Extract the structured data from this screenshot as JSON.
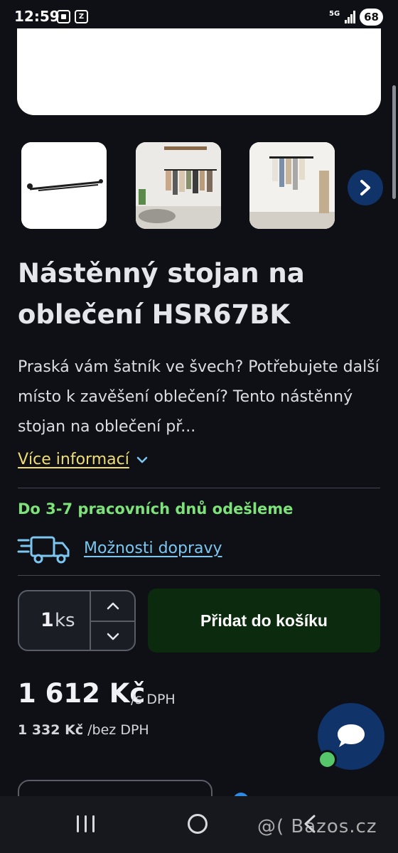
{
  "status_bar": {
    "time": "12:59",
    "network": "5G",
    "battery": "68"
  },
  "gallery": {
    "thumbnails": [
      "product-photo-rail",
      "product-photo-room",
      "product-photo-wall"
    ],
    "next_icon": "chevron-right-icon"
  },
  "product": {
    "title": "Nástěnný stojan na oblečení HSR67BK",
    "description": "Praská vám šatník ve švech? Potřebujete další místo k zavěšení oblečení? Tento nástěnný stojan na oblečení př...",
    "more_info_label": "Více informací"
  },
  "shipping": {
    "time_text": "Do 3-7 pracovních dnů odešleme",
    "options_link": "Možnosti dopravy"
  },
  "cart": {
    "quantity": "1",
    "unit": "ks",
    "add_button": "Přidat do košíku"
  },
  "price": {
    "with_vat": "1 612 Kč",
    "with_vat_suffix": "/s DPH",
    "without_vat": "1 332 Kč",
    "without_vat_suffix": "/bez DPH"
  },
  "watermark": "@( Bazos.cz",
  "colors": {
    "background": "#0e1016",
    "accent_blue": "#10336a",
    "link_yellow": "#f1de73",
    "link_blue": "#7cc6f0",
    "shipping_green": "#7ee27a",
    "cart_button": "#0b2a0e"
  }
}
